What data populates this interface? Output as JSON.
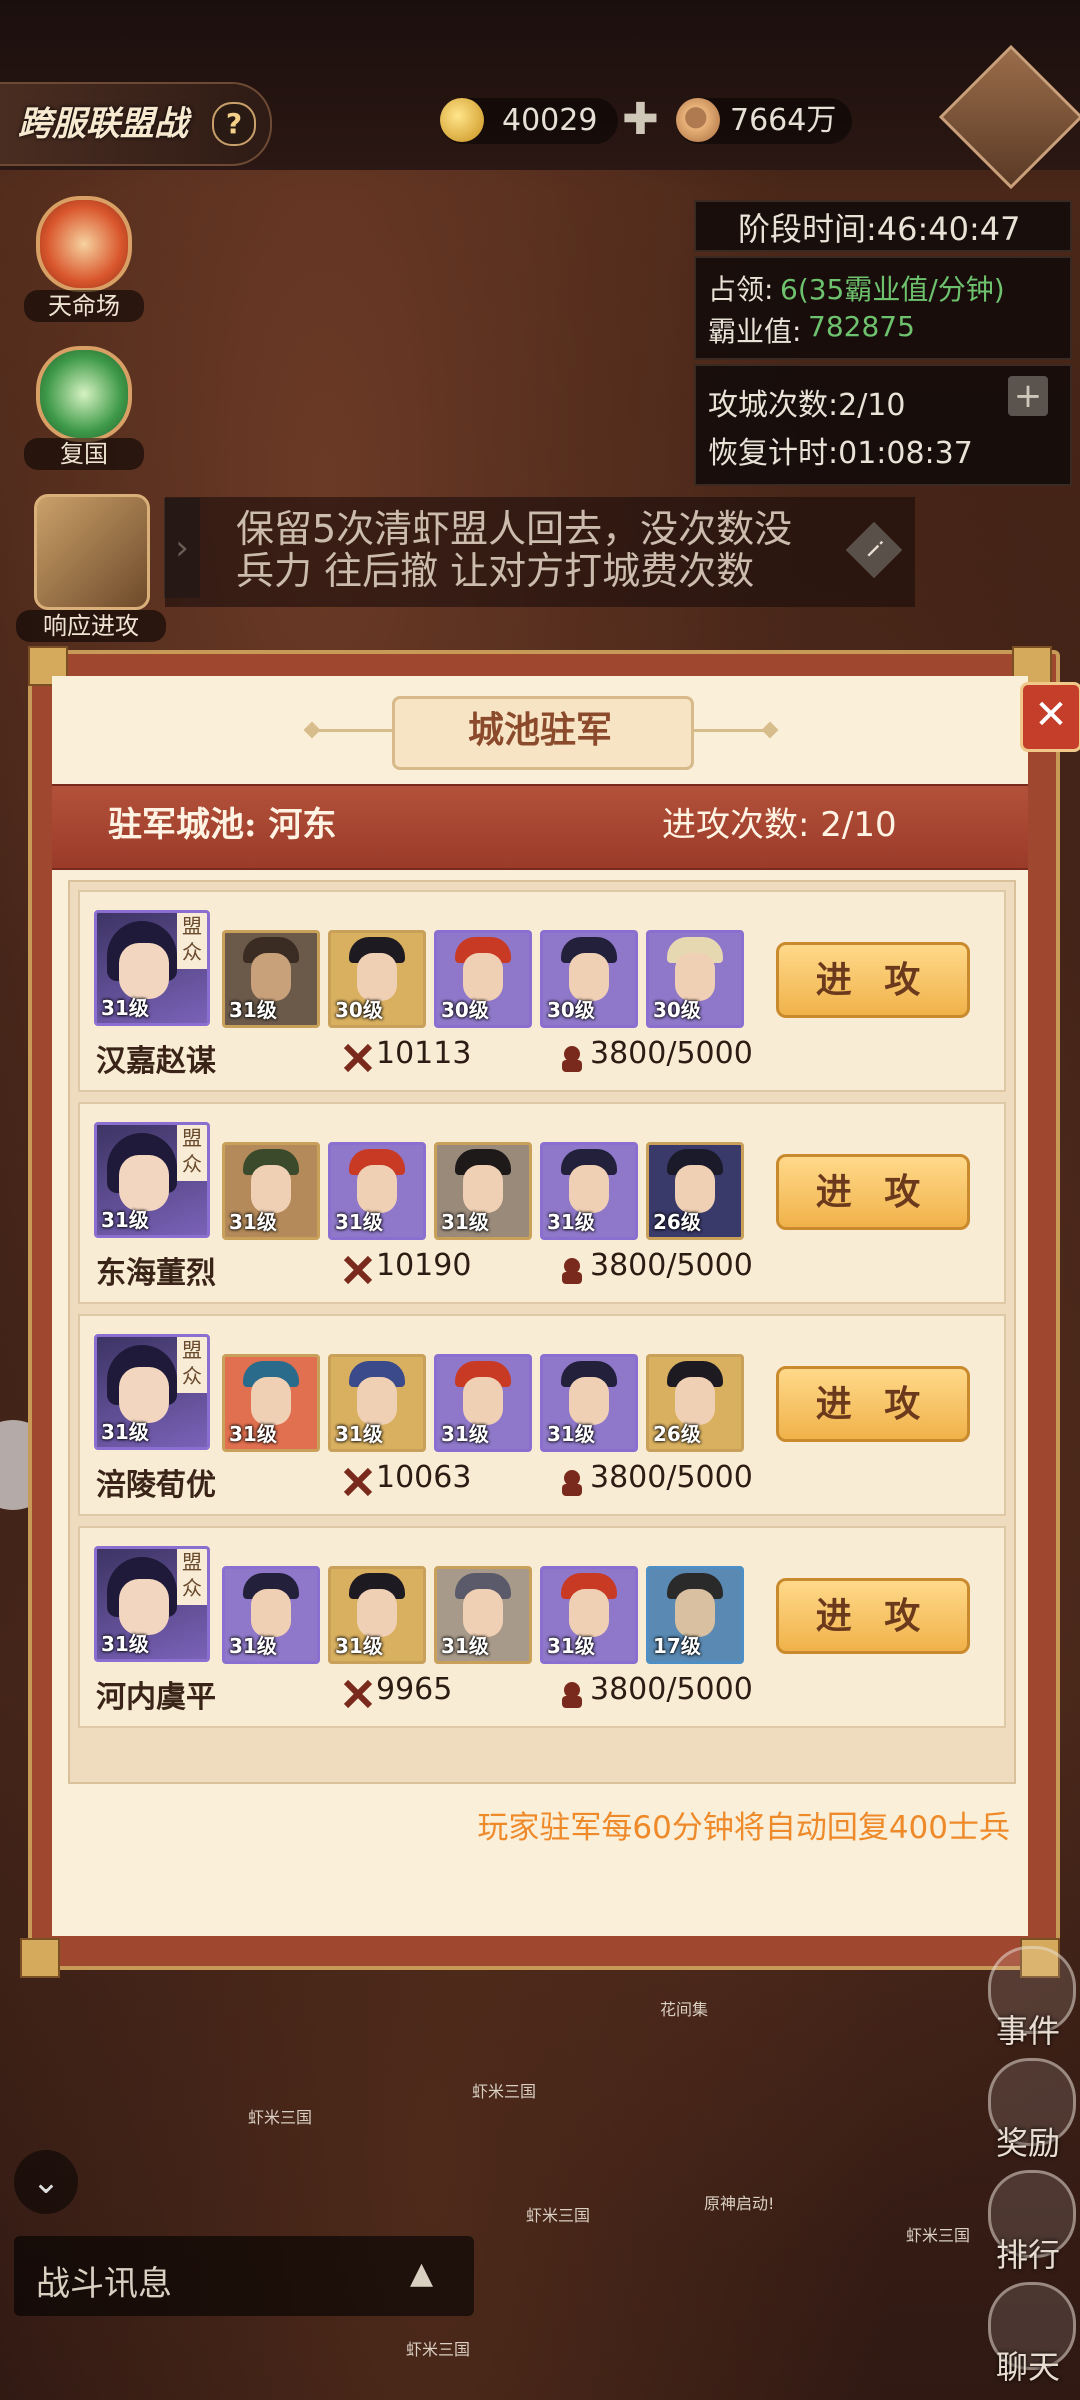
{
  "header": {
    "title": "跨服联盟战",
    "help": "?",
    "gold": "40029",
    "copper": "7664万",
    "plus": "✚"
  },
  "info": {
    "phase_time": "阶段时间:46:40:47",
    "occupy_label": "占领: ",
    "occupy_value": "6(35霸业值/分钟)",
    "hegemony_label": "霸业值: ",
    "hegemony_value": "782875",
    "attack_count": "攻城次数:2/10",
    "recover_time": "恢复计时:01:08:37",
    "add": "+"
  },
  "left_menu": {
    "destiny": "天命场",
    "restore": "复国",
    "respond": "响应进攻"
  },
  "notice": {
    "line1": "保留5次清虾盟人回去，没次数没",
    "line2": "兵力 往后撤 让对方打城费次数",
    "info_icon": "i"
  },
  "modal": {
    "title": "城池驻军",
    "close": "✕",
    "city_label": "驻军城池: 河东",
    "attack_label": "进攻次数: 2/10",
    "attack_button": "进 攻",
    "tag": "盟众",
    "rows": [
      {
        "name": "汉嘉赵谋",
        "lead_level": "31级",
        "power": "10113",
        "troops": "3800/5000",
        "heroes": [
          "31级",
          "30级",
          "30级",
          "30级",
          "30级"
        ]
      },
      {
        "name": "东海董烈",
        "lead_level": "31级",
        "power": "10190",
        "troops": "3800/5000",
        "heroes": [
          "31级",
          "31级",
          "31级",
          "31级",
          "26级"
        ]
      },
      {
        "name": "涪陵荀优",
        "lead_level": "31级",
        "power": "10063",
        "troops": "3800/5000",
        "heroes": [
          "31级",
          "31级",
          "31级",
          "31级",
          "26级"
        ]
      },
      {
        "name": "河内虞平",
        "lead_level": "31级",
        "power": "9965",
        "troops": "3800/5000",
        "heroes": [
          "31级",
          "31级",
          "31级",
          "31级",
          "17级"
        ]
      }
    ],
    "footer": "玩家驻军每60分钟将自动回复400士兵"
  },
  "bottom": {
    "battle_info": "战斗讯息",
    "event": "事件",
    "reward": "奖励",
    "rank": "排行",
    "chat": "聊天",
    "map_labels": [
      "花间集",
      "虾米三国",
      "虾米三国",
      "虾米三国",
      "原神启动!",
      "虾米三国",
      "虾米三国"
    ]
  }
}
